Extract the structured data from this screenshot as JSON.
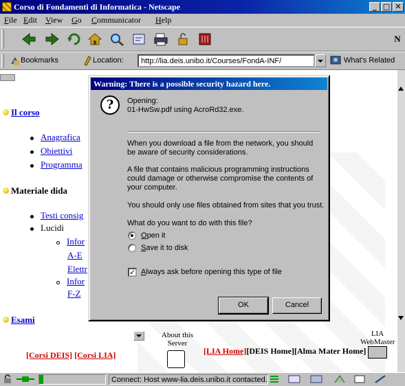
{
  "window": {
    "title": "Corso di Fondamenti di Informatica - Netscape",
    "controls": [
      "_",
      "□",
      "✕"
    ]
  },
  "menu": [
    "File",
    "Edit",
    "View",
    "Go",
    "Communicator",
    "Help"
  ],
  "location_bar": {
    "bookmarks_label": "Bookmarks",
    "location_label": "Location:",
    "url": "http://lia.deis.unibo.it/Courses/FondA-INF/",
    "related_label": "What's Related"
  },
  "page": {
    "section_corso": "Il corso",
    "corso_items": [
      "Anagrafica",
      "Obiettivi",
      "Programma"
    ],
    "section_materiale": "Materiale dida",
    "materiale_items": [
      "Testi consig",
      "Lucidi"
    ],
    "lucidi_sub": [
      "Infor",
      "A-E",
      "Elettr",
      "Infor",
      "F-Z"
    ],
    "section_esami": "Esami",
    "about_server": "About this Server",
    "lia_webmaster": "LIA WebMaster",
    "links_left": [
      "[Corsi DEIS]",
      "[Corsi LIA]"
    ],
    "lia_home": "[LIA Home]",
    "deis_home": "[DEIS Home]",
    "alma_home": "[Alma Mater Home]"
  },
  "dialog": {
    "title": "Warning: There is a possible security hazard here.",
    "opening_label": "Opening:",
    "filename": "01-HwSw.pdf using AcroRd32.exe.",
    "para1": "When you download a file from the network, you should be aware of security considerations.",
    "para2": "A file that contains malicious programming instructions could damage or otherwise compromise the contents of your computer.",
    "para3": "You should only use files obtained from sites that you trust.",
    "question": "What do you want to do with this file?",
    "option_open": "Open it",
    "option_save": "Save it to disk",
    "selected_option": "Open it",
    "always_ask_label": "Always ask before opening this type of file",
    "always_ask_checked": true,
    "ok_label": "OK",
    "cancel_label": "Cancel"
  },
  "status": {
    "text": "Connect: Host www-lia.deis.unibo.it contacted."
  },
  "colors": {
    "title_bar": "#000080",
    "link": "#0000cc",
    "red_link": "#cc0000",
    "chrome": "#c0c0c0"
  }
}
